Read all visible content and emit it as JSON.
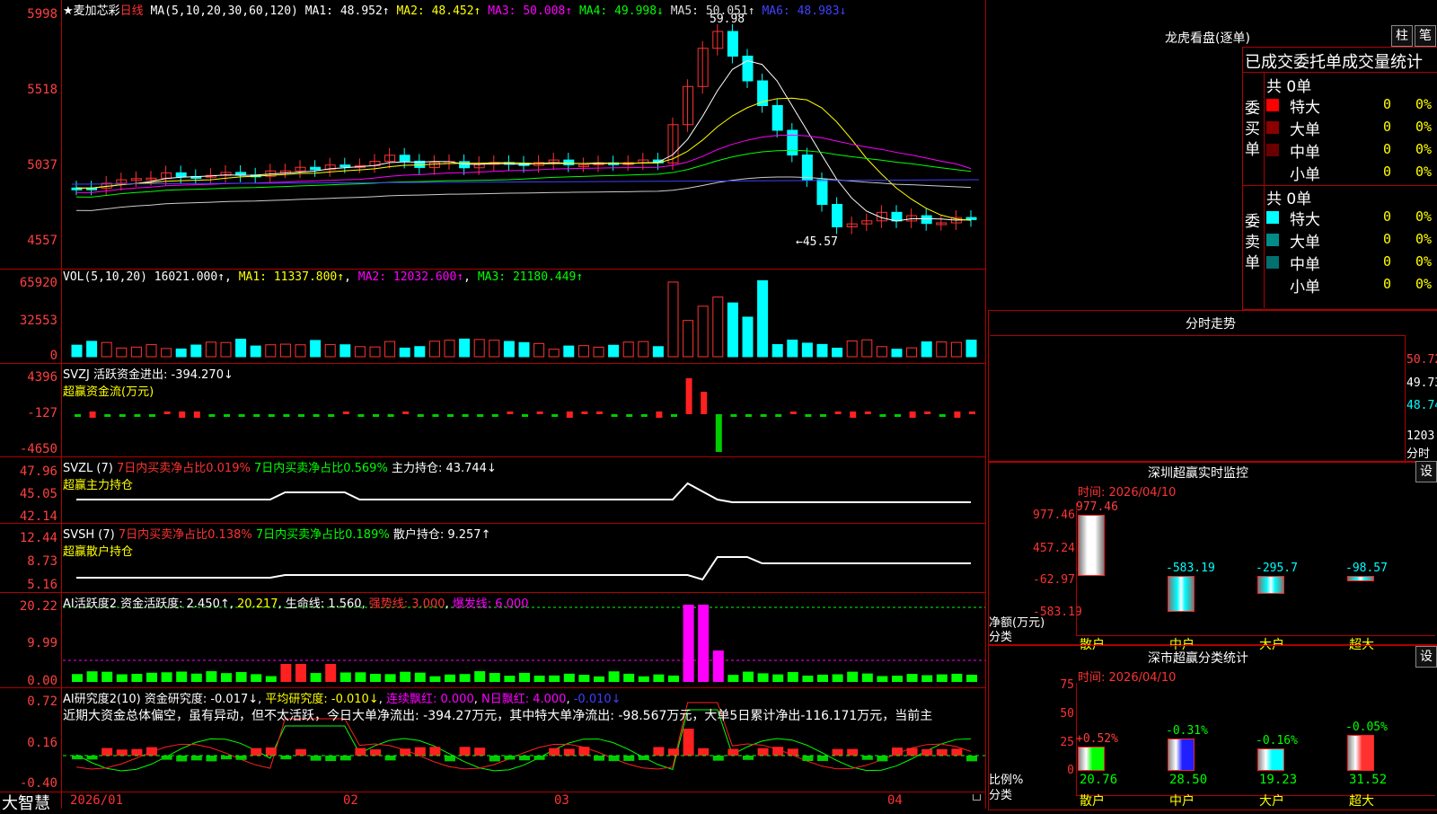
{
  "main": {
    "title": "★麦加芯彩",
    "period": "日线",
    "ma_params": "MA(5,10,20,30,60,120)",
    "ma": [
      {
        "label": "MA1: 48.952↑",
        "color": "#ffffff"
      },
      {
        "label": "MA2: 48.452↑",
        "color": "#ffff00"
      },
      {
        "label": "MA3: 50.008↑",
        "color": "#ff00ff"
      },
      {
        "label": "MA4: 49.998↓",
        "color": "#00ff00"
      },
      {
        "label": "MA5: 50.051↑",
        "color": "#dddddd"
      },
      {
        "label": "MA6: 48.983↓",
        "color": "#4040ff"
      }
    ],
    "yaxis": [
      "5998",
      "5518",
      "5037",
      "4557"
    ],
    "high_mark": "59.98",
    "low_mark": "←45.57"
  },
  "vol": {
    "label": "VOL(5,10,20)",
    "value": "16021.000↑",
    "ma1": "MA1: 11337.800↑",
    "ma2": "MA2: 12032.600↑",
    "ma3": "MA3: 21180.449↑",
    "yaxis": [
      "65920",
      "32553",
      "0"
    ]
  },
  "svzj": {
    "label": "SVZJ  活跃资金进出: -394.270↓",
    "sub": "超赢资金流(万元)",
    "yaxis": [
      "4396",
      "-127",
      "-4650"
    ]
  },
  "svzl": {
    "label": "SVZL (7)",
    "t1": "7日内买卖净占比0.019%",
    "t2": "7日内买卖净占比0.569%",
    "t3": "主力持仓: 43.744↓",
    "sub": "超赢主力持仓",
    "yaxis": [
      "47.96",
      "45.05",
      "42.14"
    ]
  },
  "svsh": {
    "label": "SVSH (7)",
    "t1": "7日内买卖净占比0.138%",
    "t2": "7日内买卖净占比0.189%",
    "t3": "散户持仓: 9.257↑",
    "sub": "超赢散户持仓",
    "yaxis": [
      "12.44",
      "8.73",
      "5.16"
    ]
  },
  "ai1": {
    "label": "AI活跃度2 资金活跃度: 2.450↑",
    "v2": "20.217",
    "life": "生命线: 1.560",
    "strong": "强势线: 3.000",
    "burst": "爆发线: 6.000",
    "yaxis": [
      "20.22",
      "9.99",
      "0.00"
    ]
  },
  "ai2": {
    "label": "AI研究度2(10) 资金研究度: -0.017↓",
    "avg": "平均研究度: -0.010↓",
    "lian": "连续飘红: 0.000",
    "n": "N日飘红: 4.000",
    "last": "-0.010↓",
    "comment": "近期大资金总体偏空，虽有异动，但不太活跃，今日大单净流出: -394.27万元，其中特大单净流出: -98.567万元，大单5日累计净出-116.171万元，当前主",
    "yaxis": [
      "0.72",
      "0.16",
      "-0.40"
    ]
  },
  "bottom": {
    "brand": "大智慧",
    "dates": [
      "2026/01",
      "02",
      "03",
      "04"
    ]
  },
  "longhu": {
    "title": "龙虎看盘(逐单)",
    "tab1": "柱",
    "tab2": "笔",
    "subtitle": "已成交委托单成交量统计",
    "buy_side": "委买单",
    "sell_side": "委卖单",
    "buy_total": "共 0单",
    "sell_total": "共 0单",
    "buy_rows": [
      {
        "name": "特大",
        "count": "0",
        "pct": "0%",
        "color": "#ff0000"
      },
      {
        "name": "大单",
        "count": "0",
        "pct": "0%",
        "color": "#8b0000"
      },
      {
        "name": "中单",
        "count": "0",
        "pct": "0%",
        "color": "#6b0000"
      },
      {
        "name": "小单",
        "count": "0",
        "pct": "0%",
        "color": ""
      }
    ],
    "sell_rows": [
      {
        "name": "特大",
        "count": "0",
        "pct": "0%",
        "color": "#00ffff"
      },
      {
        "name": "大单",
        "count": "0",
        "pct": "0%",
        "color": "#008b8b"
      },
      {
        "name": "中单",
        "count": "0",
        "pct": "0%",
        "color": "#007070"
      },
      {
        "name": "小单",
        "count": "0",
        "pct": "0%",
        "color": ""
      }
    ]
  },
  "fenshi": {
    "title": "分时走势",
    "yaxis": [
      "50.72",
      "49.73",
      "48.74"
    ],
    "vol_axis": [
      "1203",
      "分时"
    ]
  },
  "szmon": {
    "title": "深圳超赢实时监控",
    "btn": "设",
    "time": "时间: 2026/04/10",
    "yaxis": [
      "977.46",
      "457.24",
      "-62.97",
      "-583.19"
    ],
    "ylabel1": "净额(万元)",
    "ylabel2": "分类",
    "bars": [
      {
        "cat": "散户",
        "value": "977.46",
        "num": 977.46,
        "color": "#ffffff"
      },
      {
        "cat": "中户",
        "value": "-583.19",
        "num": -583.19,
        "color": "#00ffff"
      },
      {
        "cat": "大户",
        "value": "-295.7",
        "num": -295.7,
        "color": "#00ffff"
      },
      {
        "cat": "超大",
        "value": "-98.57",
        "num": -98.57,
        "color": "#00ffff"
      }
    ]
  },
  "szcls": {
    "title": "深市超赢分类统计",
    "btn": "设",
    "time": "时间: 2026/04/10",
    "yaxis": [
      "75",
      "50",
      "25",
      "0"
    ],
    "ylabel1": "比例%",
    "ylabel2": "分类",
    "bars": [
      {
        "cat": "散户",
        "delta": "+0.52%",
        "value": "20.76",
        "num": 20.76,
        "color": "#00ff00"
      },
      {
        "cat": "中户",
        "delta": "-0.31%",
        "value": "28.50",
        "num": 28.5,
        "color": "#2020ff"
      },
      {
        "cat": "大户",
        "delta": "-0.16%",
        "value": "19.23",
        "num": 19.23,
        "color": "#00ffff"
      },
      {
        "cat": "超大",
        "delta": "-0.05%",
        "value": "31.52",
        "num": 31.52,
        "color": "#ff3030"
      }
    ]
  }
}
